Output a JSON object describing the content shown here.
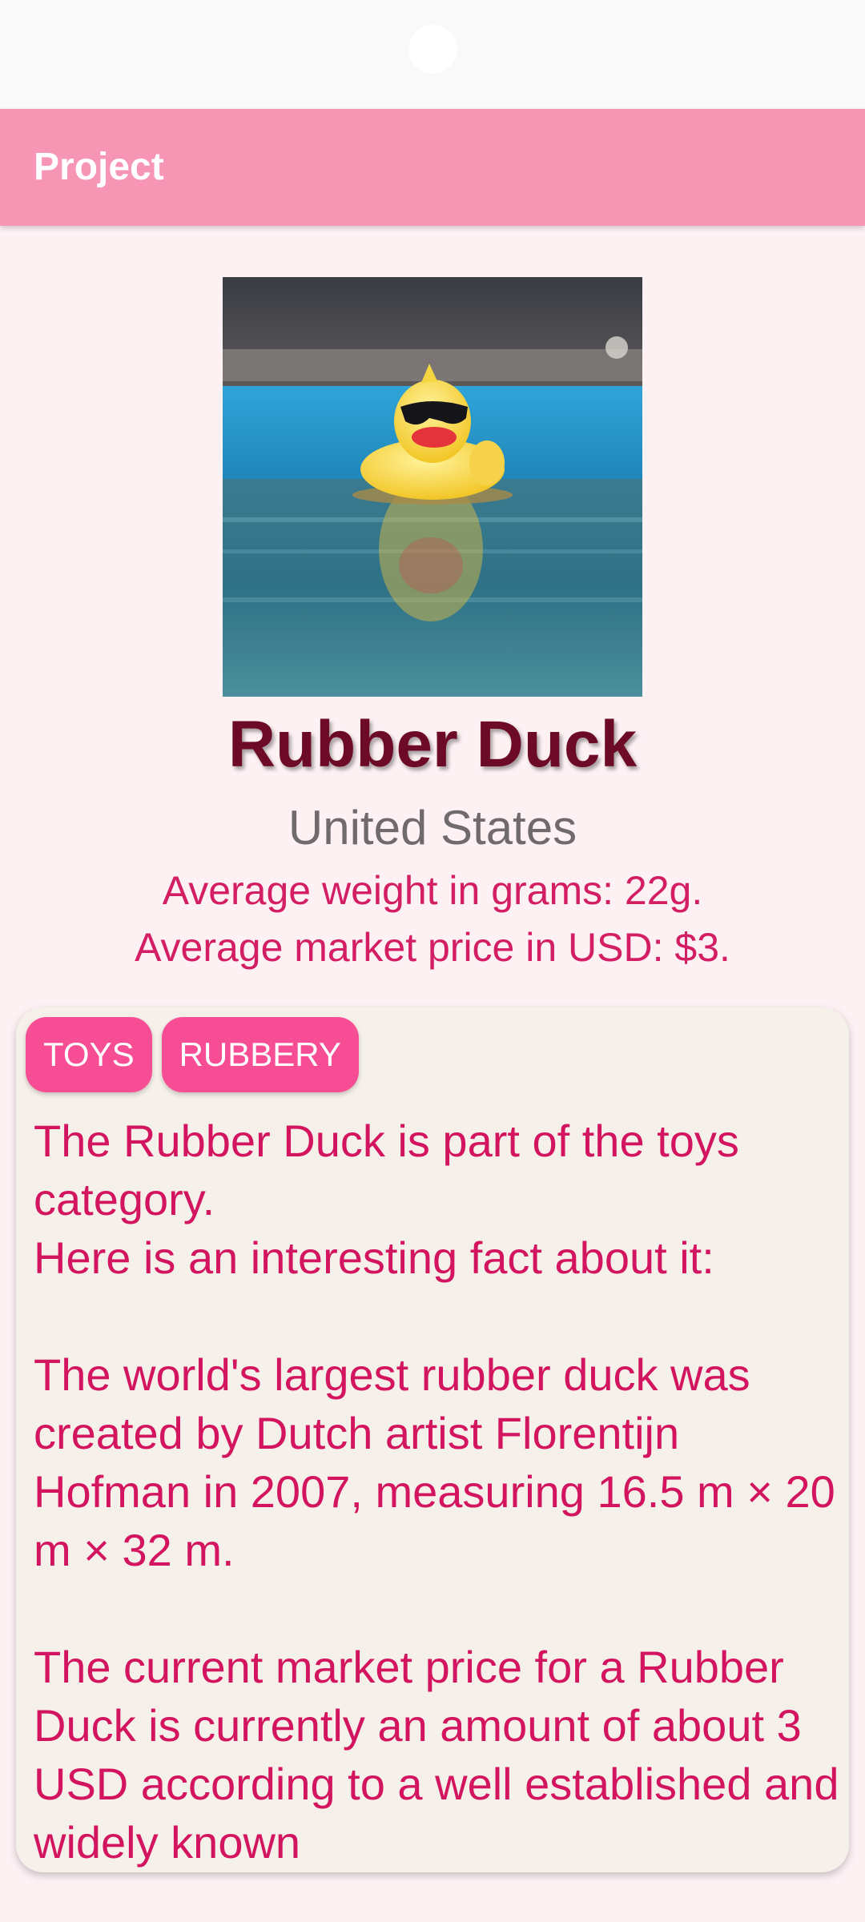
{
  "app_bar": {
    "title": "Project"
  },
  "item": {
    "name": "Rubber Duck",
    "country": "United States",
    "weight_text": "Average weight in grams: 22g.",
    "price_text": "Average market price in USD: $3."
  },
  "card": {
    "tags": [
      "TOYS",
      "RUBBERY"
    ],
    "description": "The Rubber Duck is part of the toys category.\nHere is an interesting fact about it:\n\nThe world's largest rubber duck was created by Dutch artist Florentijn Hofman in 2007, measuring 16.5 m × 20 m × 32 m.\n\nThe current market price for a Rubber Duck is currently an amount of about 3 USD according to a well established and widely known"
  },
  "colors": {
    "app_bar": "#f795b4",
    "chip": "#f74d95",
    "accent_text": "#d31e63",
    "title": "#6d0a27",
    "background": "#fdf1f4",
    "card": "#f6f0ea"
  }
}
